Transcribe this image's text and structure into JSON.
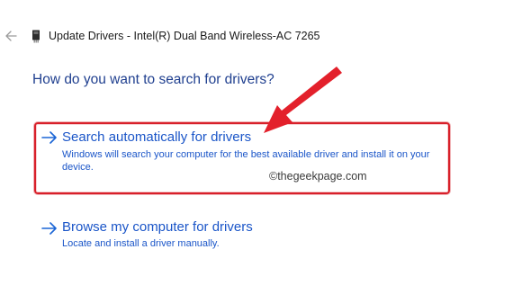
{
  "header": {
    "back_icon": "back-arrow-icon",
    "device_icon": "network-adapter-icon",
    "title": "Update Drivers - Intel(R) Dual Band Wireless-AC 7265"
  },
  "heading": "How do you want to search for drivers?",
  "options": [
    {
      "icon": "arrow-right-icon",
      "title": "Search automatically for drivers",
      "description": "Windows will search your computer for the best available driver and install it on your device.",
      "highlighted": true
    },
    {
      "icon": "arrow-right-icon",
      "title": "Browse my computer for drivers",
      "description": "Locate and install a driver manually.",
      "highlighted": false
    }
  ],
  "watermark": "©thegeekpage.com",
  "colors": {
    "heading": "#1f3f8f",
    "link": "#1a55c8",
    "arrow": "#1a65d6",
    "highlight": "#d8202a",
    "annotation_arrow": "#e3202b"
  }
}
